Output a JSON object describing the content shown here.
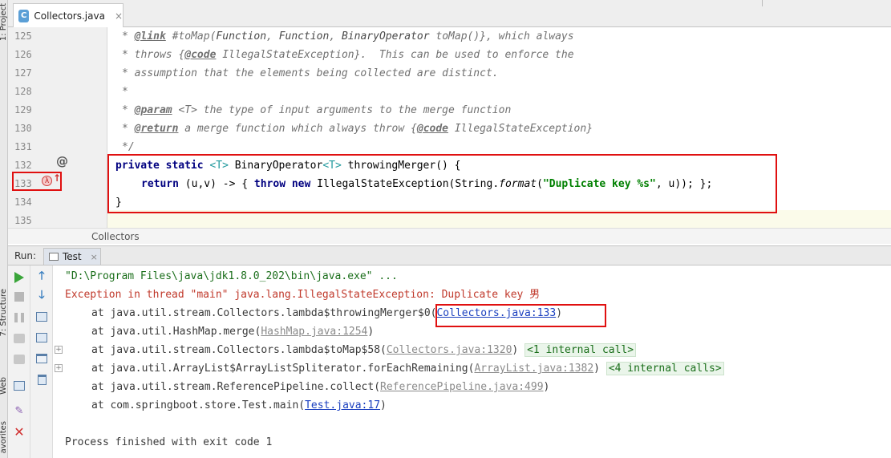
{
  "left_strip": {
    "project_label": "1: Project",
    "structure_label": "7: Structure",
    "web_label": "Web",
    "favorites_label": "avorites"
  },
  "editor_tab": {
    "file_icon": "C",
    "label": "Collectors.java",
    "close": "×"
  },
  "line_numbers": [
    "125",
    "126",
    "127",
    "128",
    "129",
    "130",
    "131",
    "132",
    "133",
    "134",
    "135"
  ],
  "gutter_icons": {
    "at_symbol": "@",
    "lambda_icon": "λ",
    "up_arrow": "↑"
  },
  "code": {
    "l125": {
      "a": "* ",
      "b": "@link",
      "c": " #toMap(",
      "d": "Function",
      "e": ", ",
      "f": "Function",
      "g": ", ",
      "h": "BinaryOperator",
      "i": " toMap()}, which always"
    },
    "l126": {
      "a": "* throws {",
      "b": "@code",
      "c": " IllegalStateException}.  This can be used to enforce the"
    },
    "l127": {
      "a": "* assumption that the elements being collected are distinct."
    },
    "l128": {
      "a": "*"
    },
    "l129": {
      "a": "* ",
      "b": "@param",
      "c": " <T> the type of input arguments to the merge function"
    },
    "l130": {
      "a": "* ",
      "b": "@return",
      "c": " a merge function which always throw {",
      "d": "@code",
      "e": " IllegalStateException}"
    },
    "l131": {
      "a": "*/"
    },
    "l132": {
      "kw1": "private",
      "kw2": "static",
      "t1": "<T>",
      "p1": " BinaryOperator",
      "t2": "<T>",
      "p2": " throwingMerger() {"
    },
    "l133": {
      "kw1": "return",
      "p1": " (u,v) -> { ",
      "kw2": "throw",
      "kw3": "new",
      "p2": " IllegalStateException(String.",
      "it": "format",
      "p3": "(",
      "str": "\"Duplicate key %s\"",
      "p4": ", u)); };"
    },
    "l134": {
      "p1": "}"
    },
    "l135": {}
  },
  "breadcrumb": "Collectors",
  "run": {
    "label": "Run:",
    "tab_label": "Test",
    "tab_close": "×"
  },
  "console": {
    "cmd": "\"D:\\Program Files\\java\\jdk1.8.0_202\\bin\\java.exe\" ...",
    "exception": "Exception in thread \"main\" java.lang.IllegalStateException: Duplicate key 男",
    "trace": [
      {
        "pre": "at java.util.stream.Collectors.lambda$throwingMerger$0(",
        "link": "Collectors.java:133",
        "post": ")",
        "link_style": "blue",
        "fold": ""
      },
      {
        "pre": "at java.util.HashMap.merge(",
        "link": "HashMap.java:1254",
        "post": ")",
        "link_style": "gray",
        "fold": ""
      },
      {
        "pre": "at java.util.stream.Collectors.lambda$toMap$58(",
        "link": "Collectors.java:1320",
        "post": ") ",
        "link_style": "gray",
        "fold": "<1 internal call>"
      },
      {
        "pre": "at java.util.ArrayList$ArrayListSpliterator.forEachRemaining(",
        "link": "ArrayList.java:1382",
        "post": ") ",
        "link_style": "gray",
        "fold": "<4 internal calls>"
      },
      {
        "pre": "at java.util.stream.ReferencePipeline.collect(",
        "link": "ReferencePipeline.java:499",
        "post": ")",
        "link_style": "gray",
        "fold": ""
      },
      {
        "pre": "at com.springboot.store.Test.main(",
        "link": "Test.java:17",
        "post": ")",
        "link_style": "blue",
        "fold": ""
      }
    ],
    "finished": "Process finished with exit code 1"
  },
  "colors": {
    "highlight_box": "#e01010",
    "keyword": "#000080",
    "error_text": "#c0392b",
    "link": "#1a3fbf",
    "run_green": "#3aa53a"
  }
}
